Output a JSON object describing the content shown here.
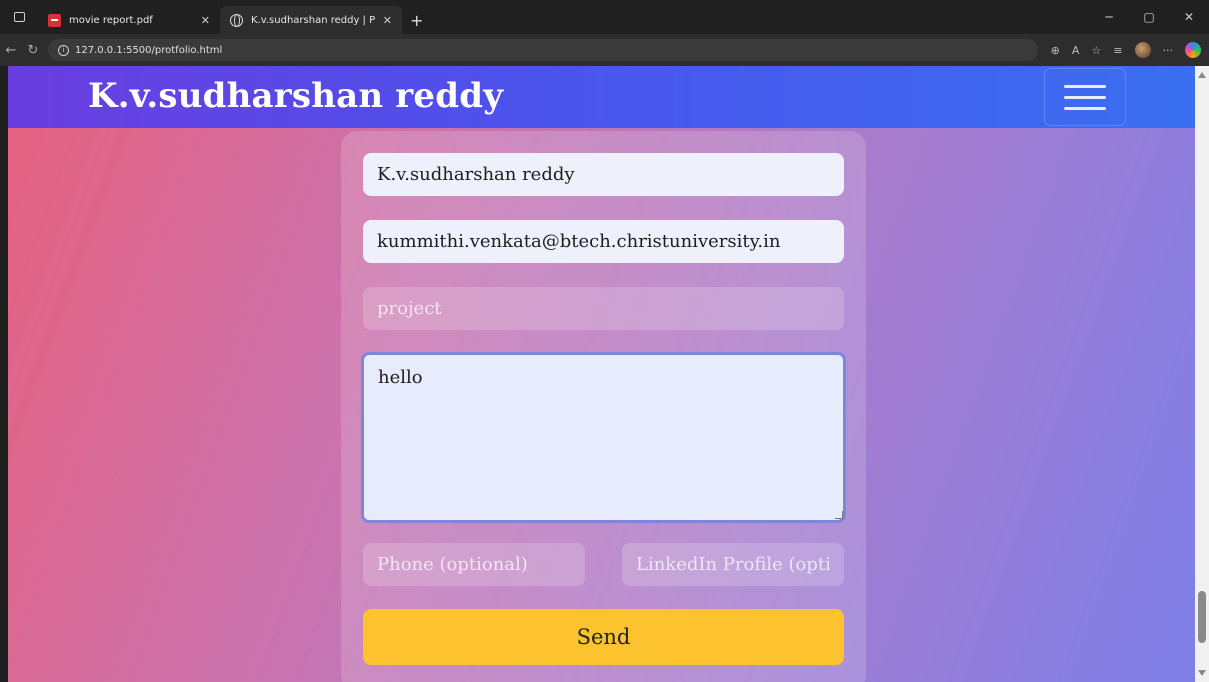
{
  "browser": {
    "tabs": [
      {
        "label": "movie report.pdf",
        "icon": "pdf-icon",
        "active": false
      },
      {
        "label": "K.v.sudharshan reddy | Portfolio",
        "icon": "globe-icon",
        "active": true
      }
    ],
    "url": "127.0.0.1:5500/protfolio.html"
  },
  "header": {
    "title": "K.v.sudharshan reddy"
  },
  "form": {
    "name_value": "K.v.sudharshan reddy",
    "email_value": "kummithi.venkata@btech.christuniversity.in",
    "subject_placeholder": "project",
    "message_value": "hello",
    "phone_placeholder": "Phone (optional)",
    "linkedin_placeholder": "LinkedIn Profile (optional)",
    "send_label": "Send"
  },
  "colors": {
    "send_button": "#fdc32e",
    "header_left": "#6a3de0",
    "header_right": "#3a6ff0"
  }
}
